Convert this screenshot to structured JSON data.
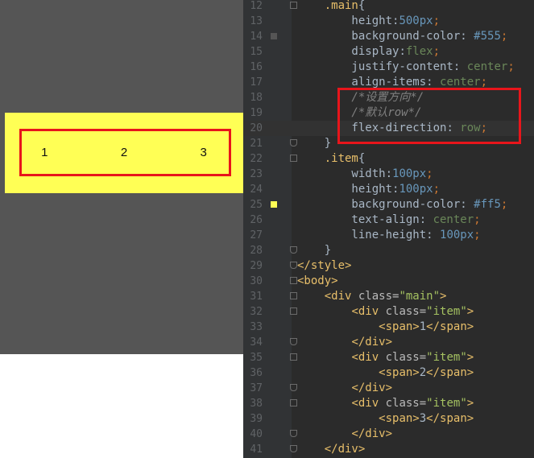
{
  "preview": {
    "items": [
      "1",
      "2",
      "3"
    ],
    "colors": {
      "main_bg": "#555555",
      "item_bg": "#ffff55",
      "highlight": "#e8151b"
    }
  },
  "editor": {
    "lines": [
      {
        "n": "12",
        "fold": "start",
        "marker": "",
        "cur": false,
        "tokens": [
          {
            "t": "    ",
            "c": "t-txt"
          },
          {
            "t": ".main",
            "c": "t-sel"
          },
          {
            "t": "{",
            "c": "t-txt"
          }
        ]
      },
      {
        "n": "13",
        "fold": "",
        "marker": "",
        "cur": false,
        "tokens": [
          {
            "t": "        height",
            "c": "t-prop"
          },
          {
            "t": ":",
            "c": "t-txt"
          },
          {
            "t": "500px",
            "c": "t-num"
          },
          {
            "t": ";",
            "c": "t-punc"
          }
        ]
      },
      {
        "n": "14",
        "fold": "",
        "marker": "#555555",
        "cur": false,
        "tokens": [
          {
            "t": "        background-color",
            "c": "t-prop"
          },
          {
            "t": ": ",
            "c": "t-txt"
          },
          {
            "t": "#555",
            "c": "t-num"
          },
          {
            "t": ";",
            "c": "t-punc"
          }
        ]
      },
      {
        "n": "15",
        "fold": "",
        "marker": "",
        "cur": false,
        "tokens": [
          {
            "t": "        display",
            "c": "t-prop"
          },
          {
            "t": ":",
            "c": "t-txt"
          },
          {
            "t": "flex",
            "c": "t-val"
          },
          {
            "t": ";",
            "c": "t-punc"
          }
        ]
      },
      {
        "n": "16",
        "fold": "",
        "marker": "",
        "cur": false,
        "tokens": [
          {
            "t": "        justify-content",
            "c": "t-prop"
          },
          {
            "t": ": ",
            "c": "t-txt"
          },
          {
            "t": "center",
            "c": "t-val"
          },
          {
            "t": ";",
            "c": "t-punc"
          }
        ]
      },
      {
        "n": "17",
        "fold": "",
        "marker": "",
        "cur": false,
        "tokens": [
          {
            "t": "        align-items",
            "c": "t-prop"
          },
          {
            "t": ": ",
            "c": "t-txt"
          },
          {
            "t": "center",
            "c": "t-val"
          },
          {
            "t": ";",
            "c": "t-punc"
          }
        ]
      },
      {
        "n": "18",
        "fold": "",
        "marker": "",
        "cur": false,
        "tokens": [
          {
            "t": "        /*设置方向*/",
            "c": "t-com"
          }
        ]
      },
      {
        "n": "19",
        "fold": "",
        "marker": "",
        "cur": false,
        "tokens": [
          {
            "t": "        /*默认row*/",
            "c": "t-com"
          }
        ]
      },
      {
        "n": "20",
        "fold": "",
        "marker": "",
        "cur": true,
        "tokens": [
          {
            "t": "        flex-direction",
            "c": "t-prop"
          },
          {
            "t": ": ",
            "c": "t-txt"
          },
          {
            "t": "row",
            "c": "t-val"
          },
          {
            "t": ";",
            "c": "t-punc"
          }
        ]
      },
      {
        "n": "21",
        "fold": "end",
        "marker": "",
        "cur": false,
        "tokens": [
          {
            "t": "    }",
            "c": "t-txt"
          }
        ]
      },
      {
        "n": "22",
        "fold": "start",
        "marker": "",
        "cur": false,
        "tokens": [
          {
            "t": "    ",
            "c": "t-txt"
          },
          {
            "t": ".item",
            "c": "t-sel"
          },
          {
            "t": "{",
            "c": "t-txt"
          }
        ]
      },
      {
        "n": "23",
        "fold": "",
        "marker": "",
        "cur": false,
        "tokens": [
          {
            "t": "        width",
            "c": "t-prop"
          },
          {
            "t": ":",
            "c": "t-txt"
          },
          {
            "t": "100px",
            "c": "t-num"
          },
          {
            "t": ";",
            "c": "t-punc"
          }
        ]
      },
      {
        "n": "24",
        "fold": "",
        "marker": "",
        "cur": false,
        "tokens": [
          {
            "t": "        height",
            "c": "t-prop"
          },
          {
            "t": ":",
            "c": "t-txt"
          },
          {
            "t": "100px",
            "c": "t-num"
          },
          {
            "t": ";",
            "c": "t-punc"
          }
        ]
      },
      {
        "n": "25",
        "fold": "",
        "marker": "#ffff55",
        "cur": false,
        "tokens": [
          {
            "t": "        background-color",
            "c": "t-prop"
          },
          {
            "t": ": ",
            "c": "t-txt"
          },
          {
            "t": "#ff5",
            "c": "t-num"
          },
          {
            "t": ";",
            "c": "t-punc"
          }
        ]
      },
      {
        "n": "26",
        "fold": "",
        "marker": "",
        "cur": false,
        "tokens": [
          {
            "t": "        text-align",
            "c": "t-prop"
          },
          {
            "t": ": ",
            "c": "t-txt"
          },
          {
            "t": "center",
            "c": "t-val"
          },
          {
            "t": ";",
            "c": "t-punc"
          }
        ]
      },
      {
        "n": "27",
        "fold": "",
        "marker": "",
        "cur": false,
        "tokens": [
          {
            "t": "        line-height",
            "c": "t-prop"
          },
          {
            "t": ": ",
            "c": "t-txt"
          },
          {
            "t": "100px",
            "c": "t-num"
          },
          {
            "t": ";",
            "c": "t-punc"
          }
        ]
      },
      {
        "n": "28",
        "fold": "end",
        "marker": "",
        "cur": false,
        "tokens": [
          {
            "t": "    }",
            "c": "t-txt"
          }
        ]
      },
      {
        "n": "29",
        "fold": "end",
        "marker": "",
        "cur": false,
        "tokens": [
          {
            "t": "</style>",
            "c": "t-tag"
          }
        ]
      },
      {
        "n": "30",
        "fold": "start",
        "marker": "",
        "cur": false,
        "tokens": [
          {
            "t": "<body>",
            "c": "t-tag"
          }
        ]
      },
      {
        "n": "31",
        "fold": "start",
        "marker": "",
        "cur": false,
        "tokens": [
          {
            "t": "    ",
            "c": "t-txt"
          },
          {
            "t": "<div ",
            "c": "t-tag"
          },
          {
            "t": "class=",
            "c": "t-attr"
          },
          {
            "t": "\"main\"",
            "c": "t-str"
          },
          {
            "t": ">",
            "c": "t-tag"
          }
        ]
      },
      {
        "n": "32",
        "fold": "start",
        "marker": "",
        "cur": false,
        "tokens": [
          {
            "t": "        ",
            "c": "t-txt"
          },
          {
            "t": "<div ",
            "c": "t-tag"
          },
          {
            "t": "class=",
            "c": "t-attr"
          },
          {
            "t": "\"item\"",
            "c": "t-str"
          },
          {
            "t": ">",
            "c": "t-tag"
          }
        ]
      },
      {
        "n": "33",
        "fold": "",
        "marker": "",
        "cur": false,
        "tokens": [
          {
            "t": "            ",
            "c": "t-txt"
          },
          {
            "t": "<span>",
            "c": "t-tag"
          },
          {
            "t": "1",
            "c": "t-txt"
          },
          {
            "t": "</span>",
            "c": "t-tag"
          }
        ]
      },
      {
        "n": "34",
        "fold": "end",
        "marker": "",
        "cur": false,
        "tokens": [
          {
            "t": "        ",
            "c": "t-txt"
          },
          {
            "t": "</div>",
            "c": "t-tag"
          }
        ]
      },
      {
        "n": "35",
        "fold": "start",
        "marker": "",
        "cur": false,
        "tokens": [
          {
            "t": "        ",
            "c": "t-txt"
          },
          {
            "t": "<div ",
            "c": "t-tag"
          },
          {
            "t": "class=",
            "c": "t-attr"
          },
          {
            "t": "\"item\"",
            "c": "t-str"
          },
          {
            "t": ">",
            "c": "t-tag"
          }
        ]
      },
      {
        "n": "36",
        "fold": "",
        "marker": "",
        "cur": false,
        "tokens": [
          {
            "t": "            ",
            "c": "t-txt"
          },
          {
            "t": "<span>",
            "c": "t-tag"
          },
          {
            "t": "2",
            "c": "t-txt"
          },
          {
            "t": "</span>",
            "c": "t-tag"
          }
        ]
      },
      {
        "n": "37",
        "fold": "end",
        "marker": "",
        "cur": false,
        "tokens": [
          {
            "t": "        ",
            "c": "t-txt"
          },
          {
            "t": "</div>",
            "c": "t-tag"
          }
        ]
      },
      {
        "n": "38",
        "fold": "start",
        "marker": "",
        "cur": false,
        "tokens": [
          {
            "t": "        ",
            "c": "t-txt"
          },
          {
            "t": "<div ",
            "c": "t-tag"
          },
          {
            "t": "class=",
            "c": "t-attr"
          },
          {
            "t": "\"item\"",
            "c": "t-str"
          },
          {
            "t": ">",
            "c": "t-tag"
          }
        ]
      },
      {
        "n": "39",
        "fold": "",
        "marker": "",
        "cur": false,
        "tokens": [
          {
            "t": "            ",
            "c": "t-txt"
          },
          {
            "t": "<span>",
            "c": "t-tag"
          },
          {
            "t": "3",
            "c": "t-txt"
          },
          {
            "t": "</span>",
            "c": "t-tag"
          }
        ]
      },
      {
        "n": "40",
        "fold": "end",
        "marker": "",
        "cur": false,
        "tokens": [
          {
            "t": "        ",
            "c": "t-txt"
          },
          {
            "t": "</div>",
            "c": "t-tag"
          }
        ]
      },
      {
        "n": "41",
        "fold": "end",
        "marker": "",
        "cur": false,
        "tokens": [
          {
            "t": "    ",
            "c": "t-txt"
          },
          {
            "t": "</div>",
            "c": "t-tag"
          }
        ]
      }
    ]
  }
}
